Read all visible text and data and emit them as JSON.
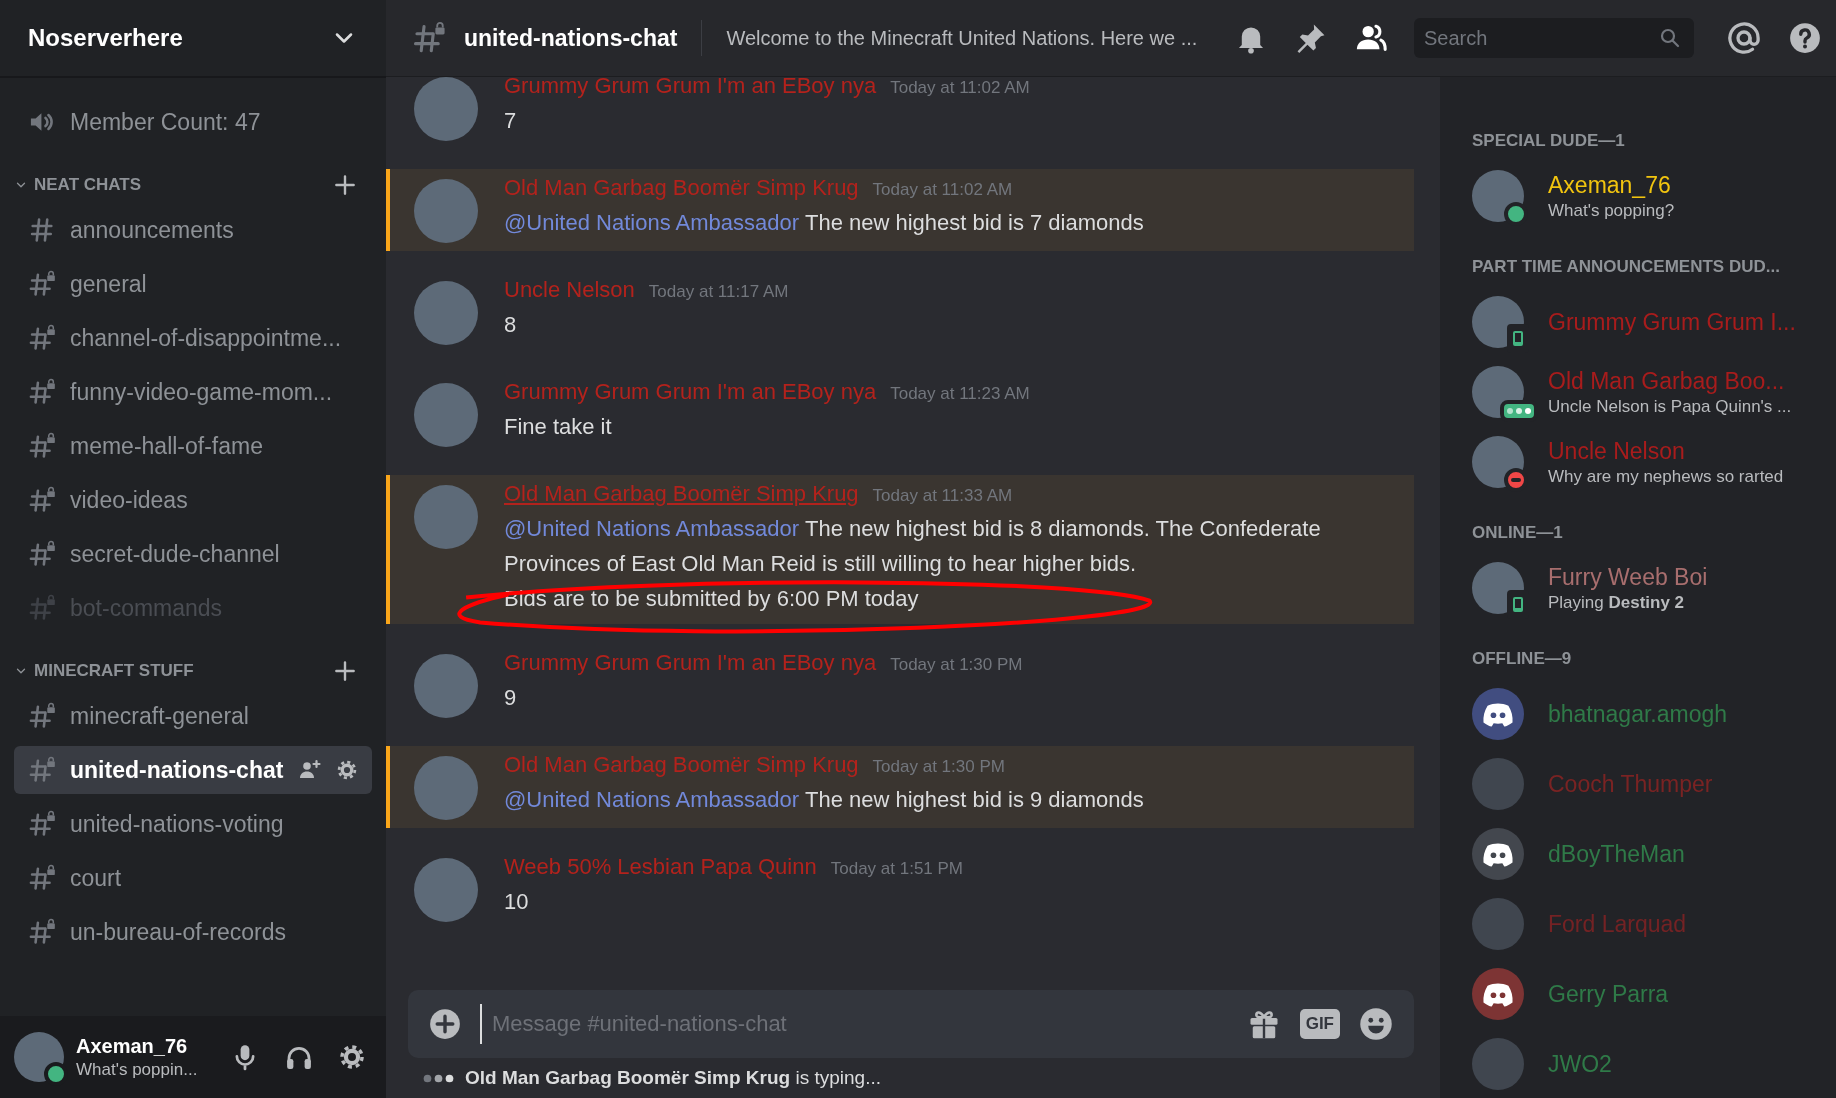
{
  "server": {
    "name": "Noserverhere"
  },
  "voice_channel": {
    "name": "Member Count: 47"
  },
  "categories": [
    {
      "name": "NEAT CHATS",
      "expanded": true,
      "channels": [
        {
          "name": "announcements",
          "locked": false,
          "muted": false,
          "selected": false
        },
        {
          "name": "general",
          "locked": true,
          "muted": false,
          "selected": false
        },
        {
          "name": "channel-of-disappointme...",
          "locked": true,
          "muted": false,
          "selected": false
        },
        {
          "name": "funny-video-game-mom...",
          "locked": true,
          "muted": false,
          "selected": false
        },
        {
          "name": "meme-hall-of-fame",
          "locked": true,
          "muted": false,
          "selected": false
        },
        {
          "name": "video-ideas",
          "locked": true,
          "muted": false,
          "selected": false
        },
        {
          "name": "secret-dude-channel",
          "locked": true,
          "muted": false,
          "selected": false
        },
        {
          "name": "bot-commands",
          "locked": true,
          "muted": true,
          "selected": false
        }
      ]
    },
    {
      "name": "MINECRAFT STUFF",
      "expanded": true,
      "channels": [
        {
          "name": "minecraft-general",
          "locked": true,
          "muted": false,
          "selected": false
        },
        {
          "name": "united-nations-chat",
          "locked": true,
          "muted": false,
          "selected": true
        },
        {
          "name": "united-nations-voting",
          "locked": true,
          "muted": false,
          "selected": false
        },
        {
          "name": "court",
          "locked": true,
          "muted": false,
          "selected": false
        },
        {
          "name": "un-bureau-of-records",
          "locked": true,
          "muted": false,
          "selected": false
        }
      ]
    }
  ],
  "user_panel": {
    "name": "Axeman_76",
    "status": "What's poppin...",
    "kind": "online"
  },
  "channel_header": {
    "name": "united-nations-chat",
    "topic": "Welcome to the Minecraft United Nations. Here we ...",
    "search_placeholder": "Search"
  },
  "messages": [
    {
      "author": "Grummy Grum Grum I'm an EBoy nya",
      "color": "#b3221c",
      "timestamp": "Today at 11:02 AM",
      "mentioned": false,
      "hovered": false,
      "body": [
        {
          "text": "7",
          "circled": false
        }
      ]
    },
    {
      "author": "Old Man Garbag Boomër Simp Krug",
      "color": "#b3221c",
      "timestamp": "Today at 11:02 AM",
      "mentioned": true,
      "hovered": false,
      "body": [
        {
          "mention": "@United Nations Ambassador",
          "text": "The new highest bid is 7 diamonds",
          "circled": false
        }
      ]
    },
    {
      "author": "Uncle Nelson",
      "color": "#b3221c",
      "timestamp": "Today at 11:17 AM",
      "mentioned": false,
      "hovered": false,
      "body": [
        {
          "text": "8",
          "circled": false
        }
      ]
    },
    {
      "author": "Grummy Grum Grum I'm an EBoy nya",
      "color": "#b3221c",
      "timestamp": "Today at 11:23 AM",
      "mentioned": false,
      "hovered": false,
      "body": [
        {
          "text": "Fine take it",
          "circled": false
        }
      ]
    },
    {
      "author": "Old Man Garbag Boomër Simp Krug",
      "color": "#b3221c",
      "timestamp": "Today at 11:33 AM",
      "mentioned": true,
      "hovered": true,
      "body": [
        {
          "mention": "@United Nations Ambassador",
          "text": "The new highest bid is 8 diamonds. The Confederate Provinces of East Old Man Reid is still willing to hear higher bids.",
          "circled": false
        },
        {
          "text": "Bids are to be submitted by 6:00 PM today",
          "circled": true
        }
      ]
    },
    {
      "author": "Grummy Grum Grum I'm an EBoy nya",
      "color": "#b3221c",
      "timestamp": "Today at 1:30 PM",
      "mentioned": false,
      "hovered": false,
      "body": [
        {
          "text": "9",
          "circled": false
        }
      ]
    },
    {
      "author": "Old Man Garbag Boomër Simp Krug",
      "color": "#b3221c",
      "timestamp": "Today at 1:30 PM",
      "mentioned": true,
      "hovered": false,
      "body": [
        {
          "mention": "@United Nations Ambassador",
          "text": "The new highest bid is 9 diamonds",
          "circled": false
        }
      ]
    },
    {
      "author": "Weeb 50% Lesbian Papa Quinn",
      "color": "#b3221c",
      "timestamp": "Today at 1:51 PM",
      "mentioned": false,
      "hovered": false,
      "body": [
        {
          "text": "10",
          "circled": false
        }
      ]
    }
  ],
  "composer": {
    "placeholder": "Message #united-nations-chat",
    "gif_label": "GIF"
  },
  "typing_indicator": "**Old Man Garbag Boomër Simp Krug** is typing...",
  "member_groups": [
    {
      "title": "SPECIAL DUDE—1",
      "offline": false,
      "members": [
        {
          "name": "Axeman_76",
          "color": "#f1c40f",
          "default_avatar": false,
          "kind": "online",
          "activity": "What's popping?"
        }
      ]
    },
    {
      "title": "PART TIME ANNOUNCEMENTS DUD...",
      "offline": false,
      "members": [
        {
          "name": "Grummy Grum Grum I...",
          "color": "#a81c1c",
          "default_avatar": false,
          "kind": "mobile"
        },
        {
          "name": "Old Man Garbag Boo...",
          "color": "#a81c1c",
          "default_avatar": false,
          "kind": "typing",
          "activity": "Uncle Nelson is Papa Quinn's ..."
        },
        {
          "name": "Uncle Nelson",
          "color": "#a81c1c",
          "default_avatar": false,
          "kind": "dnd",
          "activity": "Why are my nephews so rarted"
        }
      ]
    },
    {
      "title": "ONLINE—1",
      "offline": false,
      "members": [
        {
          "name": "Furry Weeb Boi",
          "color": "#a86e6e",
          "default_avatar": false,
          "kind": "mobile",
          "activity": "Playing **Destiny 2**"
        }
      ]
    },
    {
      "title": "OFFLINE—9",
      "offline": true,
      "members": [
        {
          "name": "bhatnagar.amogh",
          "color": "#2f7a48",
          "default_avatar": true,
          "avatar": {
            "color": "#414d80"
          }
        },
        {
          "name": "Cooch Thumper",
          "color": "#7a2323",
          "default_avatar": false
        },
        {
          "name": "dBoyTheMan",
          "color": "#2f7a48",
          "default_avatar": true,
          "avatar": {
            "color": "#43474e"
          }
        },
        {
          "name": "Ford Larquad",
          "color": "#742224",
          "default_avatar": false
        },
        {
          "name": "Gerry Parra",
          "color": "#2f7a48",
          "default_avatar": true,
          "avatar": {
            "color": "#7d3434"
          }
        },
        {
          "name": "JWO2",
          "color": "#2f7a48",
          "default_avatar": false
        }
      ]
    }
  ]
}
